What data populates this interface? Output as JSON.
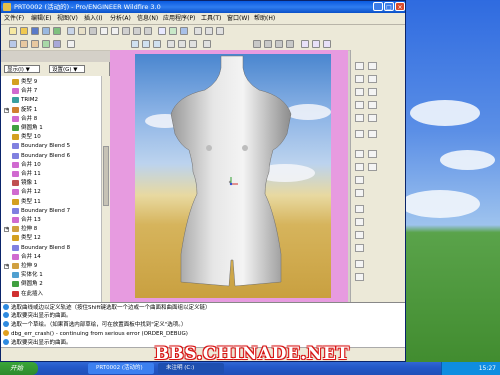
{
  "window": {
    "title": "PRT0002 (活动的) - Pro/ENGINEER Wildfire 3.0",
    "minimize_glyph": "_",
    "maximize_glyph": "□",
    "close_glyph": "×"
  },
  "menu": {
    "items": [
      "文件(F)",
      "编辑(E)",
      "视图(V)",
      "插入(I)",
      "分析(A)",
      "信息(N)",
      "应用程序(P)",
      "工具(T)",
      "窗口(W)",
      "帮助(H)"
    ]
  },
  "panel": {
    "show_label": "显示(I) ▼",
    "settings_label": "设置(G) ▼"
  },
  "tree": {
    "items": [
      {
        "label": "类型 9",
        "icon": "surface-icon",
        "expander": ""
      },
      {
        "label": "合并 7",
        "icon": "merge-icon",
        "expander": ""
      },
      {
        "label": "TRIM2",
        "icon": "trim-icon",
        "expander": ""
      },
      {
        "label": "旋转 1",
        "icon": "revolve-icon",
        "expander": "+"
      },
      {
        "label": "合并 8",
        "icon": "merge-icon",
        "expander": ""
      },
      {
        "label": "倒圆角 1",
        "icon": "round-icon",
        "expander": ""
      },
      {
        "label": "类型 10",
        "icon": "surface-icon",
        "expander": ""
      },
      {
        "label": "Boundary Blend 5",
        "icon": "blend-icon",
        "expander": ""
      },
      {
        "label": "Boundary Blend 6",
        "icon": "blend-icon",
        "expander": ""
      },
      {
        "label": "合并 10",
        "icon": "merge-icon",
        "expander": ""
      },
      {
        "label": "合并 11",
        "icon": "merge-icon",
        "expander": ""
      },
      {
        "label": "镜像 1",
        "icon": "mirror-icon",
        "expander": ""
      },
      {
        "label": "合并 12",
        "icon": "merge-icon",
        "expander": ""
      },
      {
        "label": "类型 11",
        "icon": "surface-icon",
        "expander": ""
      },
      {
        "label": "Boundary Blend 7",
        "icon": "blend-icon",
        "expander": ""
      },
      {
        "label": "合并 13",
        "icon": "merge-icon",
        "expander": ""
      },
      {
        "label": "拉伸 8",
        "icon": "extrude-icon",
        "expander": "+"
      },
      {
        "label": "类型 12",
        "icon": "surface-icon",
        "expander": ""
      },
      {
        "label": "Boundary Blend 8",
        "icon": "blend-icon",
        "expander": ""
      },
      {
        "label": "合并 14",
        "icon": "merge-icon",
        "expander": ""
      },
      {
        "label": "拉伸 9",
        "icon": "extrude-icon",
        "expander": "+"
      },
      {
        "label": "实体化 1",
        "icon": "solidify-icon",
        "expander": ""
      },
      {
        "label": "倒圆角 2",
        "icon": "round-icon",
        "expander": ""
      },
      {
        "label": "在此插入",
        "icon": "insert-here-icon",
        "expander": ""
      }
    ]
  },
  "messages": [
    {
      "text": "选取曲线或边以定义轨迹（按住Shift键选取一个边或一个曲面和曲面组以定义链）",
      "icon": "info-icon"
    },
    {
      "text": "选取要突出显示的曲面。",
      "icon": "info-icon"
    },
    {
      "text": "选取一个草绘。（如果首选内部草绘，可在放置面板中找到\"定义\"选项。）",
      "icon": "info-icon"
    },
    {
      "text": "dbg_err_crash() - continuing from serious error (ORDER_DEBUG)",
      "icon": "warning-icon"
    },
    {
      "text": "选取要突出显示的曲面。",
      "icon": "info-icon"
    }
  ],
  "taskbar": {
    "start_label": "开始",
    "tasks": [
      "PRT0002 (活动的)",
      "未注明 (C:)"
    ],
    "clock": "15:27"
  },
  "watermark": "BBS.CHINADE.NET",
  "colors": {
    "graphics_background": "#e79be0",
    "titlebar": "#0a5ae0",
    "watermark_outline": "#d81818"
  }
}
